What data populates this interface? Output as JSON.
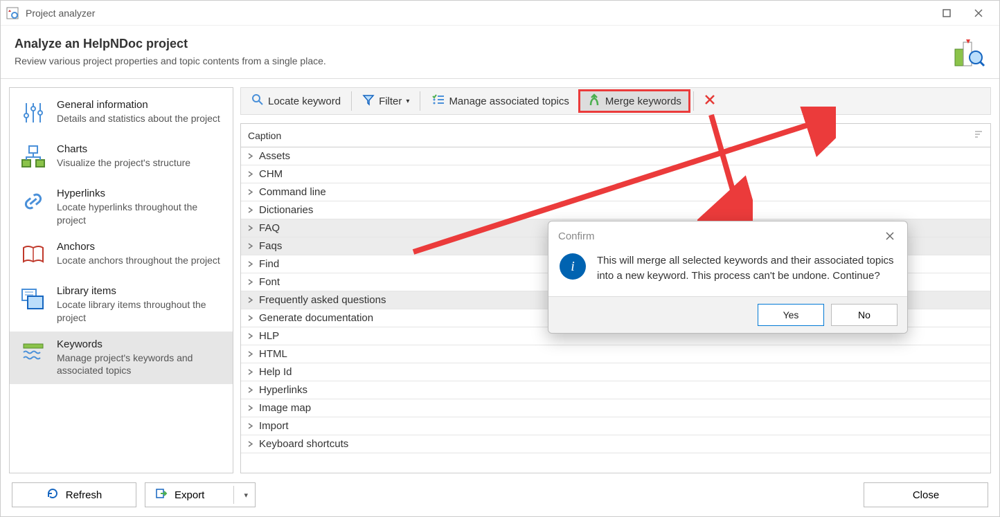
{
  "window": {
    "title": "Project analyzer"
  },
  "header": {
    "title": "Analyze an HelpNDoc project",
    "subtitle": "Review various project properties and topic contents from a single place."
  },
  "sidebar": {
    "items": [
      {
        "title": "General information",
        "desc": "Details and statistics about the project"
      },
      {
        "title": "Charts",
        "desc": "Visualize the project's structure"
      },
      {
        "title": "Hyperlinks",
        "desc": "Locate hyperlinks throughout the project"
      },
      {
        "title": "Anchors",
        "desc": "Locate anchors throughout the project"
      },
      {
        "title": "Library items",
        "desc": "Locate library items throughout the project"
      },
      {
        "title": "Keywords",
        "desc": "Manage project's keywords and associated topics"
      }
    ],
    "selected_index": 5
  },
  "toolbar": {
    "locate": "Locate keyword",
    "filter": "Filter",
    "manage": "Manage associated topics",
    "merge": "Merge keywords"
  },
  "table": {
    "header": "Caption",
    "rows": [
      "Assets",
      "CHM",
      "Command line",
      "Dictionaries",
      "FAQ",
      "Faqs",
      "Find",
      "Font",
      "Frequently asked questions",
      "Generate documentation",
      "HLP",
      "HTML",
      "Help Id",
      "Hyperlinks",
      "Image map",
      "Import",
      "Keyboard shortcuts"
    ],
    "selected_indexes": [
      4,
      5,
      8
    ]
  },
  "footer": {
    "refresh": "Refresh",
    "export": "Export",
    "close": "Close"
  },
  "dialog": {
    "title": "Confirm",
    "message": "This will merge all selected keywords and their associated topics into a new keyword. This process can't be undone. Continue?",
    "yes": "Yes",
    "no": "No"
  }
}
